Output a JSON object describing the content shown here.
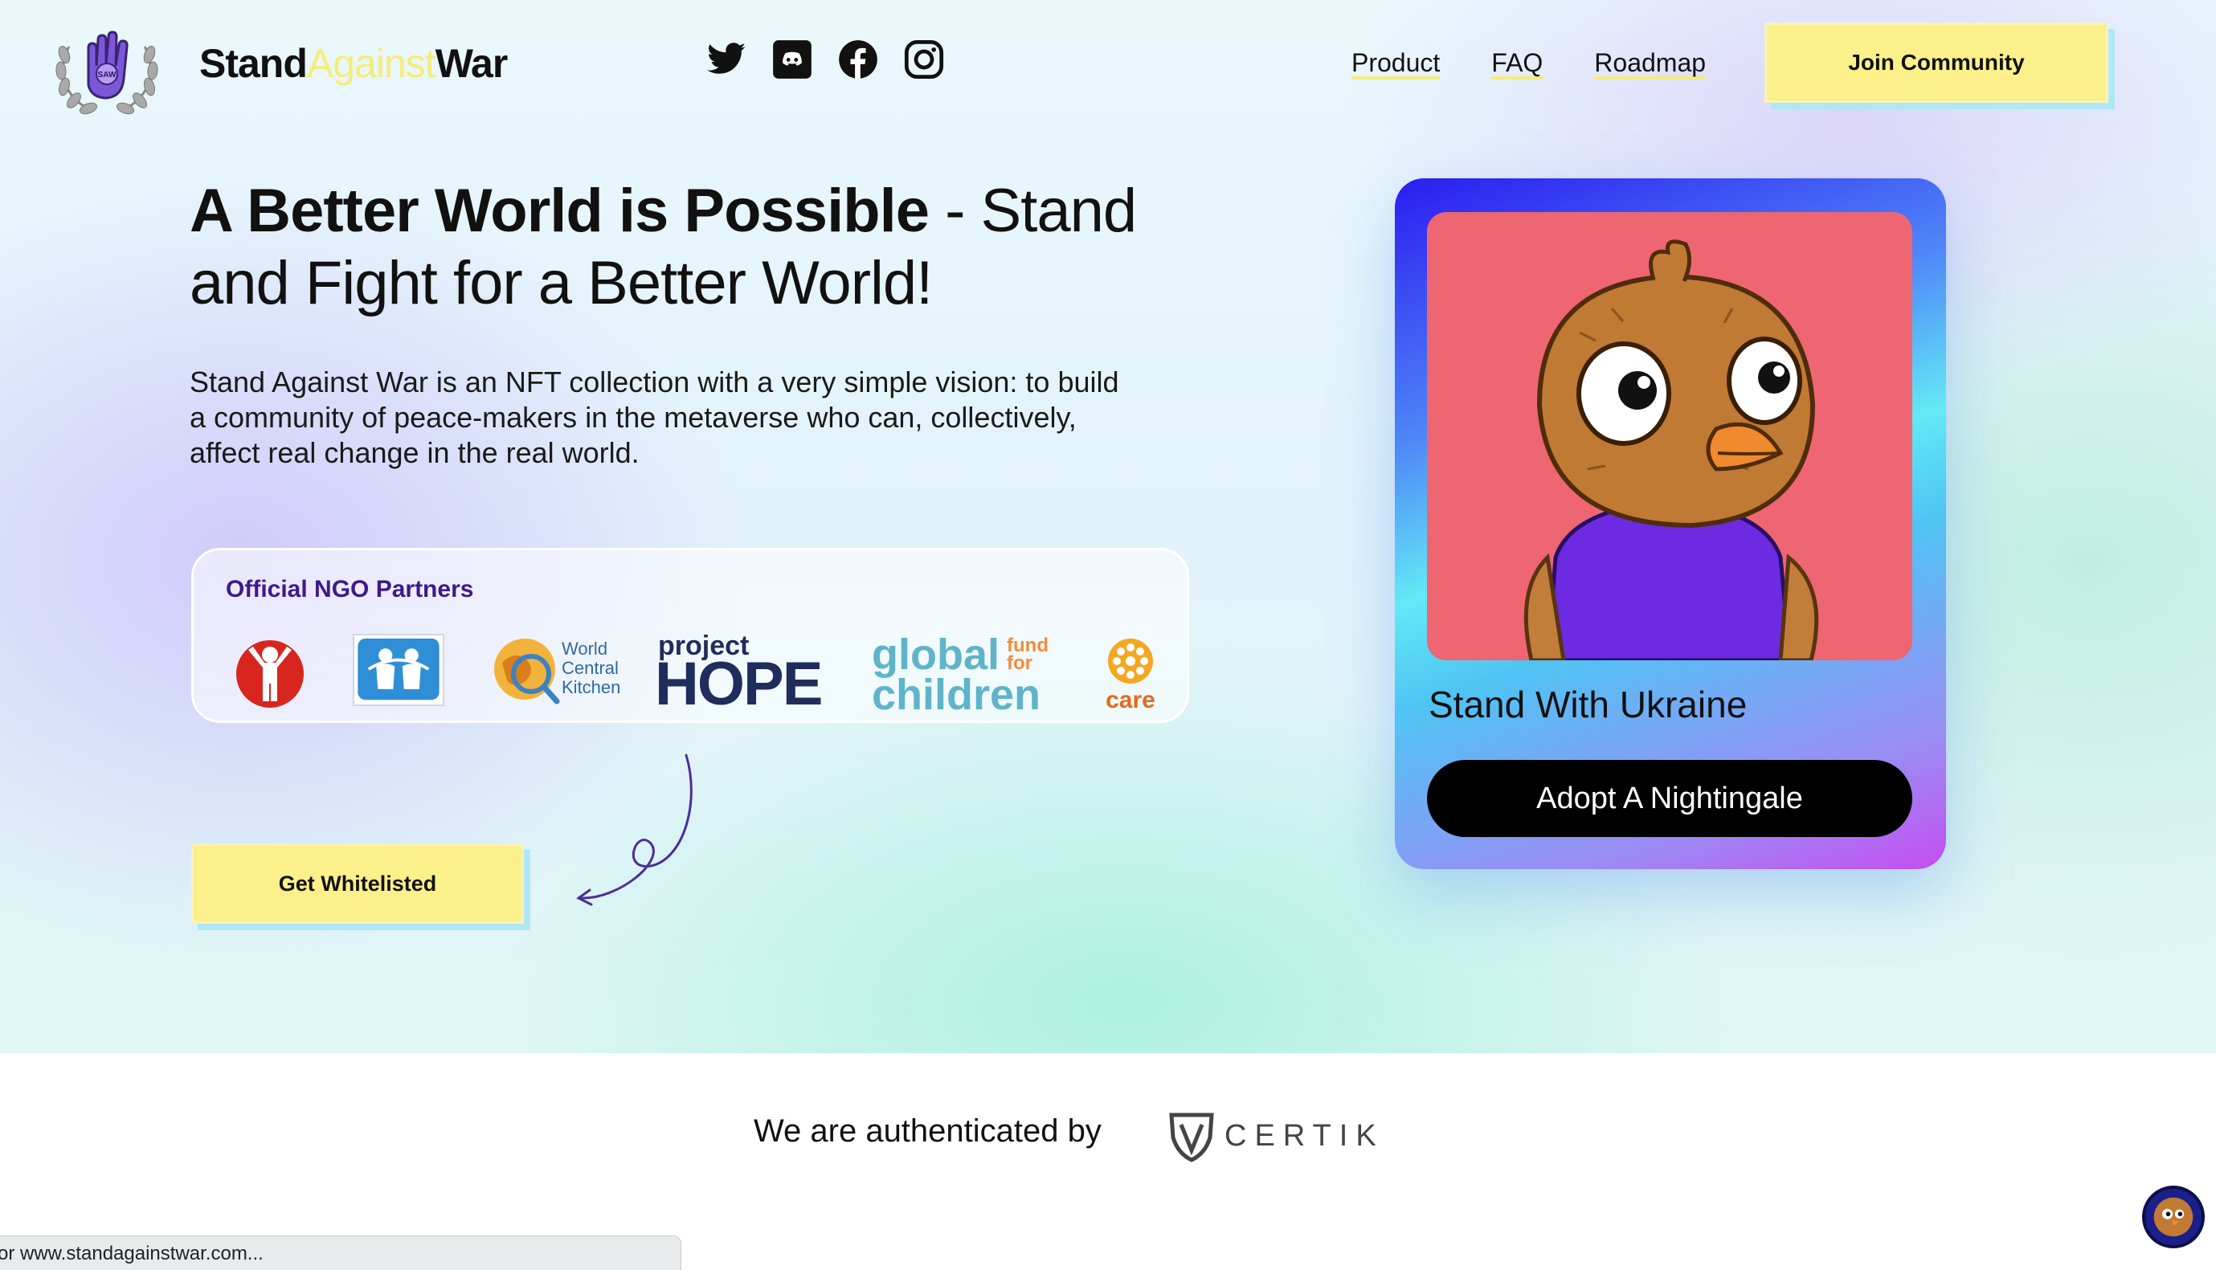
{
  "header": {
    "brand": {
      "part1": "Stand",
      "part2": "Against",
      "part3": "War"
    },
    "emblem_text": "SAW",
    "socials": [
      "twitter-icon",
      "discord-icon",
      "facebook-icon",
      "instagram-icon"
    ],
    "nav": [
      "Product",
      "FAQ",
      "Roadmap"
    ],
    "join_label": "Join Community"
  },
  "hero": {
    "headline_bold": "A Better World is Possible",
    "headline_rest": " - Stand and Fight for a Better World!",
    "description": "Stand Against War is an NFT collection with a very simple vision: to build a community of peace-makers in the metaverse who can, collectively, affect real change in the real world.",
    "whitelist_label": "Get Whitelisted"
  },
  "partners": {
    "title": "Official NGO Partners",
    "logos": [
      {
        "name": "save-the-children-logo"
      },
      {
        "name": "sos-childrens-villages-logo"
      },
      {
        "name": "world-central-kitchen-logo",
        "line1": "World",
        "line2": "Central",
        "line3": "Kitchen"
      },
      {
        "name": "project-hope-logo",
        "top": "project",
        "bottom": "HOPE"
      },
      {
        "name": "global-fund-for-children-logo",
        "big1": "global",
        "big2": "children",
        "small1": "fund",
        "small2": "for"
      },
      {
        "name": "care-logo",
        "text": "care"
      }
    ]
  },
  "card": {
    "title": "Stand With Ukraine",
    "button_label": "Adopt A Nightingale"
  },
  "auth": {
    "text": "We are authenticated by",
    "partner": "CERTIK"
  },
  "status_bar": {
    "text": "or www.standagainstwar.com..."
  },
  "colors": {
    "accent_yellow": "#fbf08a",
    "brand_mid_yellow": "#f6ec7a",
    "partners_title": "#3d1a8a",
    "card_image_bg": "#ed6672"
  }
}
